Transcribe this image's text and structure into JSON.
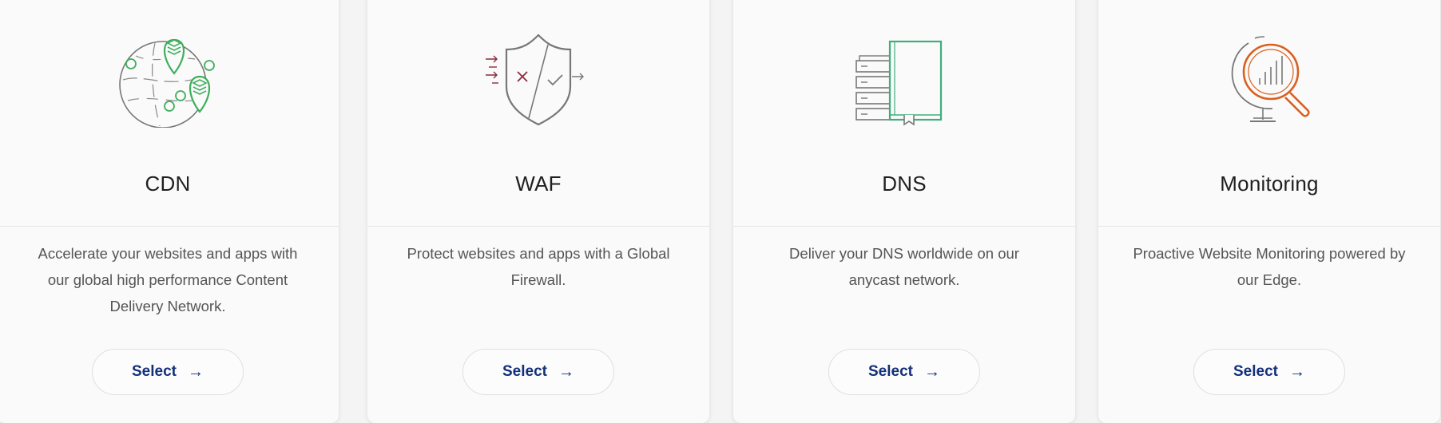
{
  "cards": [
    {
      "title": "CDN",
      "description": "Accelerate your websites and apps with our global high performance Content Delivery Network.",
      "button_label": "Select",
      "arrow": "→",
      "icon": "globe-location-pins-icon",
      "accent": "#3fae5c"
    },
    {
      "title": "WAF",
      "description": "Protect websites and apps with a Global Firewall.",
      "button_label": "Select",
      "arrow": "→",
      "icon": "shield-firewall-icon",
      "accent": "#8a2b3d"
    },
    {
      "title": "DNS",
      "description": "Deliver your DNS worldwide on our anycast network.",
      "button_label": "Select",
      "arrow": "→",
      "icon": "server-book-icon",
      "accent": "#3fae7c"
    },
    {
      "title": "Monitoring",
      "description": "Proactive Website Monitoring powered by our Edge.",
      "button_label": "Select",
      "arrow": "→",
      "icon": "globe-magnifier-icon",
      "accent": "#d9601f"
    }
  ],
  "colors": {
    "button_text": "#12307a",
    "title_text": "#1f1f1f",
    "body_text": "#555555",
    "page_background": "#f4f4f4"
  }
}
